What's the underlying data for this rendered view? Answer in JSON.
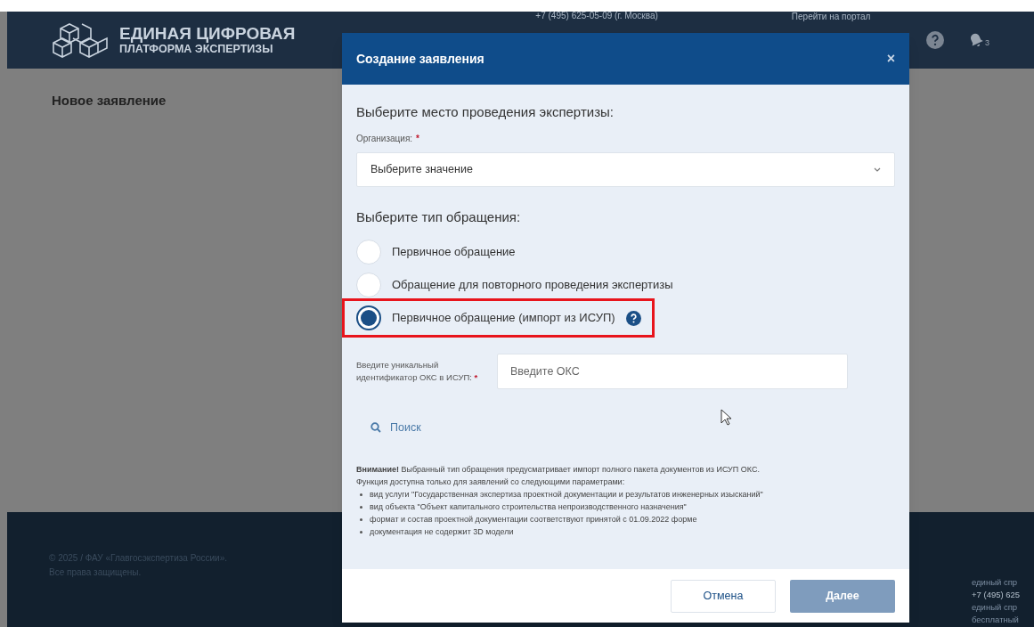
{
  "header": {
    "logo_line1": "ЕДИНАЯ ЦИФРОВАЯ",
    "logo_line2": "ПЛАТФОРМА ЭКСПЕРТИЗЫ",
    "phone": "+7 (495) 625-05-09 (г. Москва)",
    "portal_link": "Перейти на портал",
    "notifications_count": "3"
  },
  "page_title": "Новое заявление",
  "footer": {
    "copyright": [
      "© 2025 / ФАУ «Главгосэкспертиза России».",
      "Все права защищены."
    ],
    "contacts": [
      "единый спр",
      "+7 (495) 625",
      "единый спр",
      "бесплатный"
    ]
  },
  "modal": {
    "title": "Создание заявления",
    "close": "×",
    "place_heading": "Выберите место проведения экспертизы:",
    "org_label": "Организация:",
    "required_mark": "*",
    "org_placeholder": "Выберите значение",
    "type_heading": "Выберите тип обращения:",
    "options": [
      {
        "label": "Первичное обращение",
        "selected": false,
        "help": false,
        "highlighted": false
      },
      {
        "label": "Обращение для повторного проведения экспертизы",
        "selected": false,
        "help": false,
        "highlighted": false
      },
      {
        "label": "Первичное обращение (импорт из ИСУП)",
        "selected": true,
        "help": true,
        "highlighted": true
      }
    ],
    "oks_label": "Введите уникальный идентификатор ОКС в ИСУП:",
    "oks_required_mark": "*",
    "oks_placeholder": "Введите ОКС",
    "search": "Поиск",
    "notice": [
      "**Внимание!** Выбранный тип обращения предусматривает импорт полного пакета документов из ИСУП ОКС.",
      "Функция доступна только для заявлений со следующими параметрами:"
    ],
    "notice_bullets": [
      "вид услуги \"Государственная экспертиза проектной документации и результатов инженерных изысканий\"",
      "вид объекта \"Объект капитального строительства непроизводственного назначения\"",
      "формат и состав проектной документации соответствуют принятой с 01.09.2022 форме",
      "документация не содержит 3D модели"
    ],
    "buttons": [
      {
        "label": "Отмена",
        "kind": "secondary",
        "disabled": false
      },
      {
        "label": "Далее",
        "kind": "primary",
        "disabled": true
      }
    ]
  }
}
